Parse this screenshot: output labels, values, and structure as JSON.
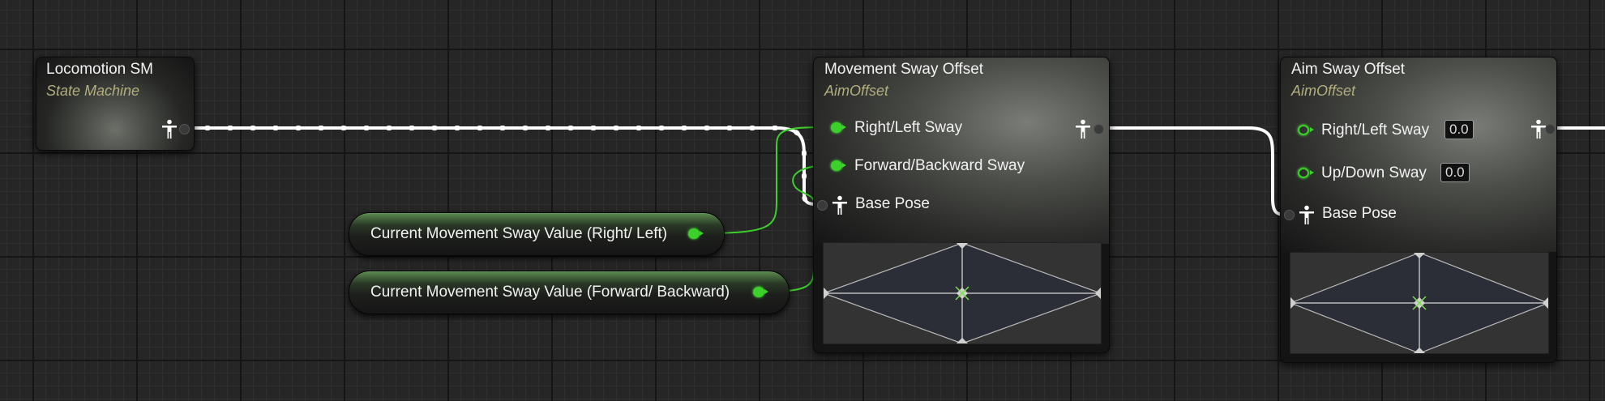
{
  "nodes": {
    "locomotion": {
      "title": "Locomotion SM",
      "subtitle": "State Machine"
    },
    "movement_sway": {
      "title": "Movement Sway Offset",
      "subtitle": "AimOffset",
      "pins": {
        "right_left": "Right/Left Sway",
        "forward_backward": "Forward/Backward Sway",
        "base_pose": "Base Pose"
      }
    },
    "aim_sway": {
      "title": "Aim Sway Offset",
      "subtitle": "AimOffset",
      "pins": {
        "right_left": "Right/Left Sway",
        "right_left_value": "0.0",
        "up_down": "Up/Down Sway",
        "up_down_value": "0.0",
        "base_pose": "Base Pose"
      }
    }
  },
  "variables": {
    "right_left": "Current Movement Sway Value (Right/ Left)",
    "forward_backward": "Current Movement Sway Value (Forward/ Backward)"
  },
  "colors": {
    "float_pin": "#3bd02a",
    "exec_wire": "#ffffff",
    "grid_background": "#262626",
    "subtitle": "#b2ae7f"
  },
  "icons": {
    "pose_pin": "person-pose-icon",
    "float_pin": "green-dot-icon"
  }
}
